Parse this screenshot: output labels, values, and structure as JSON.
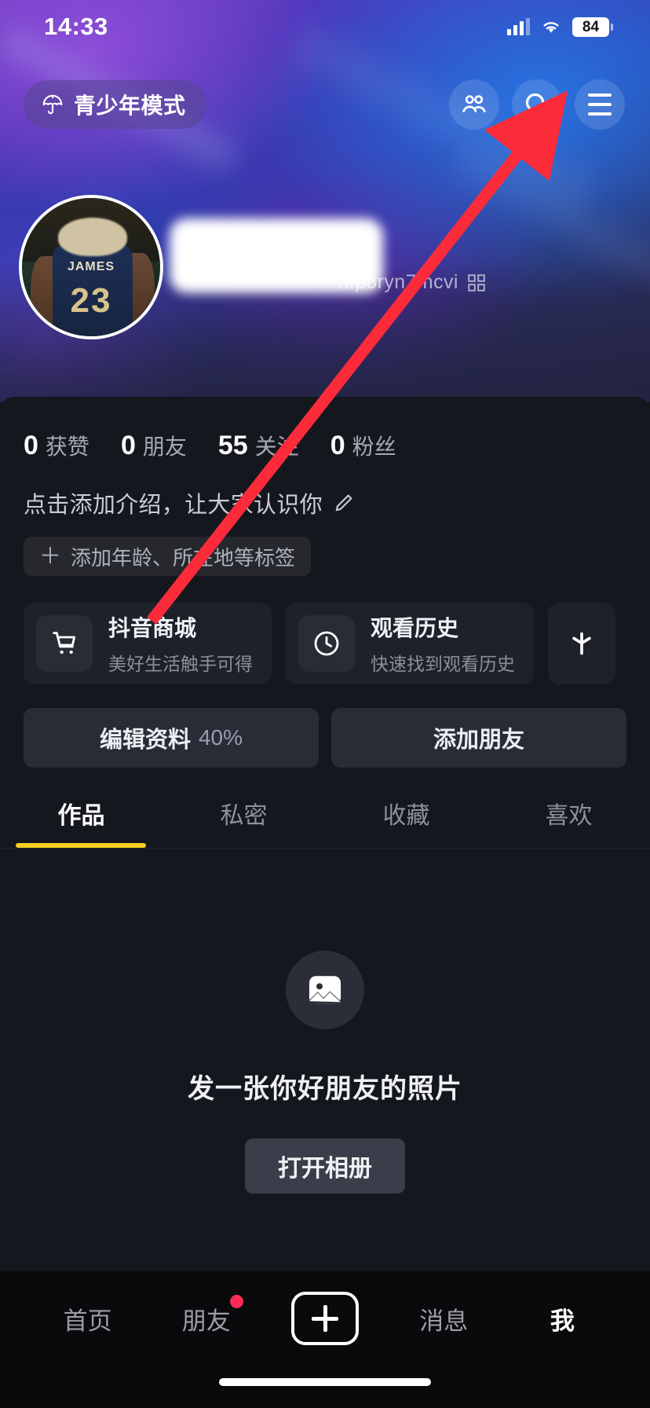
{
  "status_bar": {
    "time": "14:33",
    "battery_level": "84",
    "signal_icon": "cellular-signal-icon",
    "wifi_icon": "wifi-icon"
  },
  "header": {
    "teen_mode_label": "青少年模式",
    "teen_mode_icon": "umbrella-icon",
    "friends_icon": "people-icon",
    "search_icon": "search-icon",
    "menu_icon": "hamburger-menu-icon"
  },
  "profile": {
    "avatar_alt": "JAMES",
    "avatar_number": "23",
    "display_name_redacted": "",
    "douyin_id": "...p8ryn7mcvi",
    "qr_icon": "qr-code-icon"
  },
  "stats": [
    {
      "num": "0",
      "label": "获赞"
    },
    {
      "num": "0",
      "label": "朋友"
    },
    {
      "num": "55",
      "label": "关注"
    },
    {
      "num": "0",
      "label": "粉丝"
    }
  ],
  "bio": {
    "placeholder": "点击添加介绍，让大家认识你",
    "edit_icon": "pencil-edit-icon",
    "tag_plus": "＋",
    "tag_label": "添加年龄、所在地等标签"
  },
  "shortcut_cards": [
    {
      "title": "抖音商城",
      "subtitle": "美好生活触手可得",
      "icon": "shopping-cart-icon"
    },
    {
      "title": "观看历史",
      "subtitle": "快速找到观看历史",
      "icon": "clock-history-icon"
    }
  ],
  "shortcut_card_partial": {
    "icon": "sparkle-asterisk-icon"
  },
  "actions": {
    "edit_profile_label": "编辑资料",
    "edit_profile_percent": "40%",
    "add_friend_label": "添加朋友"
  },
  "tabs": [
    {
      "label": "作品",
      "active": true
    },
    {
      "label": "私密",
      "active": false
    },
    {
      "label": "收藏",
      "active": false
    },
    {
      "label": "喜欢",
      "active": false
    }
  ],
  "empty_state": {
    "icon": "image-placeholder-icon",
    "text": "发一张你好朋友的照片",
    "button_label": "打开相册"
  },
  "bottom_nav": [
    {
      "label": "首页",
      "active": false,
      "badge": false
    },
    {
      "label": "朋友",
      "active": false,
      "badge": true
    },
    {
      "label": "消息",
      "active": false,
      "badge": false
    },
    {
      "label": "我",
      "active": true,
      "badge": false
    }
  ],
  "create_button": {
    "icon": "plus-icon"
  },
  "annotation": {
    "type": "red-arrow",
    "points_to": "hamburger-menu-icon"
  },
  "colors": {
    "accent_yellow": "#f5d020",
    "badge_red": "#fa2c55",
    "annotation_red": "#fc2b3a",
    "panel_bg": "#15171e",
    "nav_bg": "#0a0a0c"
  }
}
